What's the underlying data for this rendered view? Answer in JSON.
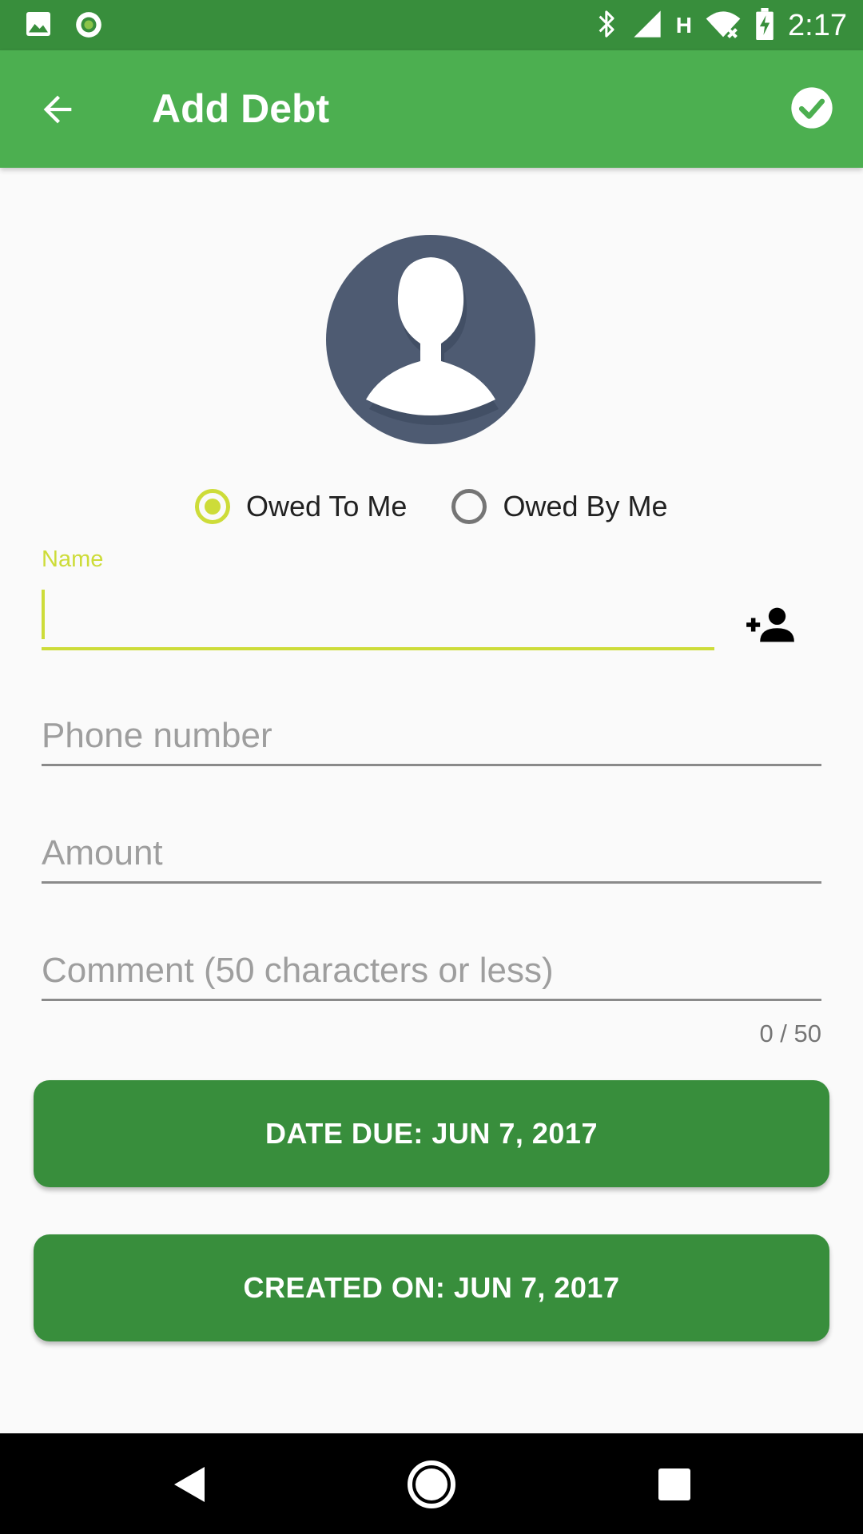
{
  "status_bar": {
    "time": "2:17",
    "network_type": "H",
    "icons": [
      "image-icon",
      "circle-notification-icon",
      "bluetooth-icon",
      "signal-icon",
      "wifi-off-icon",
      "battery-charging-icon"
    ]
  },
  "app_bar": {
    "title": "Add Debt",
    "back_icon": "arrow-back-icon",
    "done_icon": "check-circle-icon",
    "color": "#4caf50",
    "status_color": "#388e3c"
  },
  "avatar": {
    "icon": "person-avatar-icon",
    "color": "#4e5b72"
  },
  "debt_type": {
    "options": [
      {
        "label": "Owed To Me",
        "selected": true
      },
      {
        "label": "Owed By Me",
        "selected": false
      }
    ],
    "accent": "#cddc39"
  },
  "form": {
    "name": {
      "label": "Name",
      "value": ""
    },
    "add_contact_icon": "person-add-icon",
    "phone": {
      "placeholder": "Phone number",
      "value": ""
    },
    "amount": {
      "placeholder": "Amount",
      "value": ""
    },
    "comment": {
      "placeholder": "Comment (50 characters or less)",
      "value": "",
      "counter": "0 / 50"
    }
  },
  "buttons": {
    "date_due": "DATE DUE: JUN 7, 2017",
    "created_on": "CREATED ON: JUN 7, 2017",
    "color": "#388e3c"
  },
  "nav_bar": {
    "icons": [
      "nav-back-icon",
      "nav-home-icon",
      "nav-recents-icon"
    ]
  }
}
